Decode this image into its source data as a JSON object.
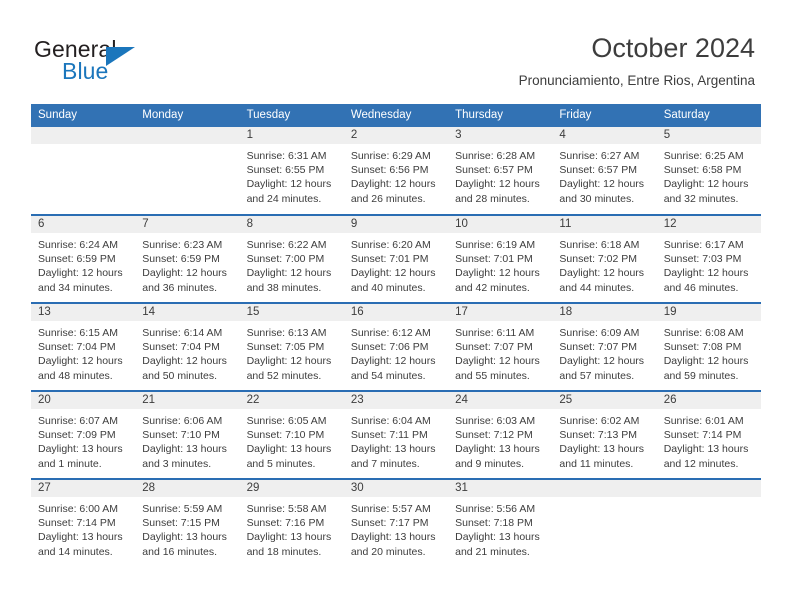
{
  "brand": {
    "name_part1": "General",
    "name_part2": "Blue",
    "logo_icon": "triangle-icon",
    "accent_color": "#1b76bc"
  },
  "header": {
    "title": "October 2024",
    "subtitle": "Pronunciamiento, Entre Rios, Argentina"
  },
  "theme": {
    "header_row_bg": "#3272b4",
    "row_divider": "#2a6db3",
    "daynum_band_bg": "#efefef",
    "text": "#3d3d3d"
  },
  "calendar": {
    "weekday_headers": [
      "Sunday",
      "Monday",
      "Tuesday",
      "Wednesday",
      "Thursday",
      "Friday",
      "Saturday"
    ],
    "weeks": [
      [
        {
          "day": "",
          "sunrise": "",
          "sunset": "",
          "daylight": "",
          "empty": true
        },
        {
          "day": "",
          "sunrise": "",
          "sunset": "",
          "daylight": "",
          "empty": true
        },
        {
          "day": "1",
          "sunrise": "Sunrise: 6:31 AM",
          "sunset": "Sunset: 6:55 PM",
          "daylight": "Daylight: 12 hours and 24 minutes."
        },
        {
          "day": "2",
          "sunrise": "Sunrise: 6:29 AM",
          "sunset": "Sunset: 6:56 PM",
          "daylight": "Daylight: 12 hours and 26 minutes."
        },
        {
          "day": "3",
          "sunrise": "Sunrise: 6:28 AM",
          "sunset": "Sunset: 6:57 PM",
          "daylight": "Daylight: 12 hours and 28 minutes."
        },
        {
          "day": "4",
          "sunrise": "Sunrise: 6:27 AM",
          "sunset": "Sunset: 6:57 PM",
          "daylight": "Daylight: 12 hours and 30 minutes."
        },
        {
          "day": "5",
          "sunrise": "Sunrise: 6:25 AM",
          "sunset": "Sunset: 6:58 PM",
          "daylight": "Daylight: 12 hours and 32 minutes."
        }
      ],
      [
        {
          "day": "6",
          "sunrise": "Sunrise: 6:24 AM",
          "sunset": "Sunset: 6:59 PM",
          "daylight": "Daylight: 12 hours and 34 minutes."
        },
        {
          "day": "7",
          "sunrise": "Sunrise: 6:23 AM",
          "sunset": "Sunset: 6:59 PM",
          "daylight": "Daylight: 12 hours and 36 minutes."
        },
        {
          "day": "8",
          "sunrise": "Sunrise: 6:22 AM",
          "sunset": "Sunset: 7:00 PM",
          "daylight": "Daylight: 12 hours and 38 minutes."
        },
        {
          "day": "9",
          "sunrise": "Sunrise: 6:20 AM",
          "sunset": "Sunset: 7:01 PM",
          "daylight": "Daylight: 12 hours and 40 minutes."
        },
        {
          "day": "10",
          "sunrise": "Sunrise: 6:19 AM",
          "sunset": "Sunset: 7:01 PM",
          "daylight": "Daylight: 12 hours and 42 minutes."
        },
        {
          "day": "11",
          "sunrise": "Sunrise: 6:18 AM",
          "sunset": "Sunset: 7:02 PM",
          "daylight": "Daylight: 12 hours and 44 minutes."
        },
        {
          "day": "12",
          "sunrise": "Sunrise: 6:17 AM",
          "sunset": "Sunset: 7:03 PM",
          "daylight": "Daylight: 12 hours and 46 minutes."
        }
      ],
      [
        {
          "day": "13",
          "sunrise": "Sunrise: 6:15 AM",
          "sunset": "Sunset: 7:04 PM",
          "daylight": "Daylight: 12 hours and 48 minutes."
        },
        {
          "day": "14",
          "sunrise": "Sunrise: 6:14 AM",
          "sunset": "Sunset: 7:04 PM",
          "daylight": "Daylight: 12 hours and 50 minutes."
        },
        {
          "day": "15",
          "sunrise": "Sunrise: 6:13 AM",
          "sunset": "Sunset: 7:05 PM",
          "daylight": "Daylight: 12 hours and 52 minutes."
        },
        {
          "day": "16",
          "sunrise": "Sunrise: 6:12 AM",
          "sunset": "Sunset: 7:06 PM",
          "daylight": "Daylight: 12 hours and 54 minutes."
        },
        {
          "day": "17",
          "sunrise": "Sunrise: 6:11 AM",
          "sunset": "Sunset: 7:07 PM",
          "daylight": "Daylight: 12 hours and 55 minutes."
        },
        {
          "day": "18",
          "sunrise": "Sunrise: 6:09 AM",
          "sunset": "Sunset: 7:07 PM",
          "daylight": "Daylight: 12 hours and 57 minutes."
        },
        {
          "day": "19",
          "sunrise": "Sunrise: 6:08 AM",
          "sunset": "Sunset: 7:08 PM",
          "daylight": "Daylight: 12 hours and 59 minutes."
        }
      ],
      [
        {
          "day": "20",
          "sunrise": "Sunrise: 6:07 AM",
          "sunset": "Sunset: 7:09 PM",
          "daylight": "Daylight: 13 hours and 1 minute."
        },
        {
          "day": "21",
          "sunrise": "Sunrise: 6:06 AM",
          "sunset": "Sunset: 7:10 PM",
          "daylight": "Daylight: 13 hours and 3 minutes."
        },
        {
          "day": "22",
          "sunrise": "Sunrise: 6:05 AM",
          "sunset": "Sunset: 7:10 PM",
          "daylight": "Daylight: 13 hours and 5 minutes."
        },
        {
          "day": "23",
          "sunrise": "Sunrise: 6:04 AM",
          "sunset": "Sunset: 7:11 PM",
          "daylight": "Daylight: 13 hours and 7 minutes."
        },
        {
          "day": "24",
          "sunrise": "Sunrise: 6:03 AM",
          "sunset": "Sunset: 7:12 PM",
          "daylight": "Daylight: 13 hours and 9 minutes."
        },
        {
          "day": "25",
          "sunrise": "Sunrise: 6:02 AM",
          "sunset": "Sunset: 7:13 PM",
          "daylight": "Daylight: 13 hours and 11 minutes."
        },
        {
          "day": "26",
          "sunrise": "Sunrise: 6:01 AM",
          "sunset": "Sunset: 7:14 PM",
          "daylight": "Daylight: 13 hours and 12 minutes."
        }
      ],
      [
        {
          "day": "27",
          "sunrise": "Sunrise: 6:00 AM",
          "sunset": "Sunset: 7:14 PM",
          "daylight": "Daylight: 13 hours and 14 minutes."
        },
        {
          "day": "28",
          "sunrise": "Sunrise: 5:59 AM",
          "sunset": "Sunset: 7:15 PM",
          "daylight": "Daylight: 13 hours and 16 minutes."
        },
        {
          "day": "29",
          "sunrise": "Sunrise: 5:58 AM",
          "sunset": "Sunset: 7:16 PM",
          "daylight": "Daylight: 13 hours and 18 minutes."
        },
        {
          "day": "30",
          "sunrise": "Sunrise: 5:57 AM",
          "sunset": "Sunset: 7:17 PM",
          "daylight": "Daylight: 13 hours and 20 minutes."
        },
        {
          "day": "31",
          "sunrise": "Sunrise: 5:56 AM",
          "sunset": "Sunset: 7:18 PM",
          "daylight": "Daylight: 13 hours and 21 minutes."
        },
        {
          "day": "",
          "sunrise": "",
          "sunset": "",
          "daylight": "",
          "empty": true
        },
        {
          "day": "",
          "sunrise": "",
          "sunset": "",
          "daylight": "",
          "empty": true
        }
      ]
    ]
  }
}
